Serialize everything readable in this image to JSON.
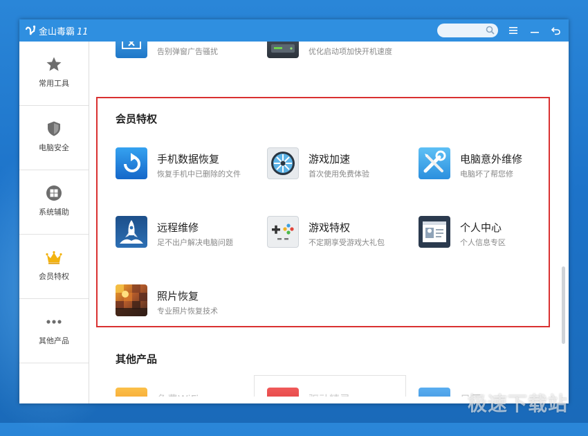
{
  "app": {
    "title": "金山毒霸",
    "version": "11"
  },
  "sidebar": {
    "items": [
      {
        "label": "常用工具",
        "icon": "star-icon"
      },
      {
        "label": "电脑安全",
        "icon": "shield-icon"
      },
      {
        "label": "系统辅助",
        "icon": "windows-icon"
      },
      {
        "label": "会员特权",
        "icon": "crown-icon"
      },
      {
        "label": "其他产品",
        "icon": "more-dots-icon"
      }
    ]
  },
  "top_partial": [
    {
      "desc": "告别弹窗广告骚扰"
    },
    {
      "desc": "优化启动项加快开机速度"
    }
  ],
  "vip": {
    "title": "会员特权",
    "items": [
      {
        "title": "手机数据恢复",
        "desc": "恢复手机中已删除的文件",
        "icon": "phone-recovery-icon"
      },
      {
        "title": "游戏加速",
        "desc": "首次使用免费体验",
        "icon": "game-accelerate-icon"
      },
      {
        "title": "电脑意外维修",
        "desc": "电脑坏了帮您修",
        "icon": "repair-tools-icon"
      },
      {
        "title": "远程维修",
        "desc": "足不出户解决电脑问题",
        "icon": "remote-rocket-icon"
      },
      {
        "title": "游戏特权",
        "desc": "不定期享受游戏大礼包",
        "icon": "gamepad-icon"
      },
      {
        "title": "个人中心",
        "desc": "个人信息专区",
        "icon": "id-card-icon"
      },
      {
        "title": "照片恢复",
        "desc": "专业照片恢复技术",
        "icon": "photo-recovery-icon"
      }
    ]
  },
  "other": {
    "title": "其他产品",
    "items": [
      {
        "title": "免费WiFi"
      },
      {
        "title": "驱动精灵"
      },
      {
        "title": "日历"
      }
    ]
  },
  "watermark": "极速下载站"
}
